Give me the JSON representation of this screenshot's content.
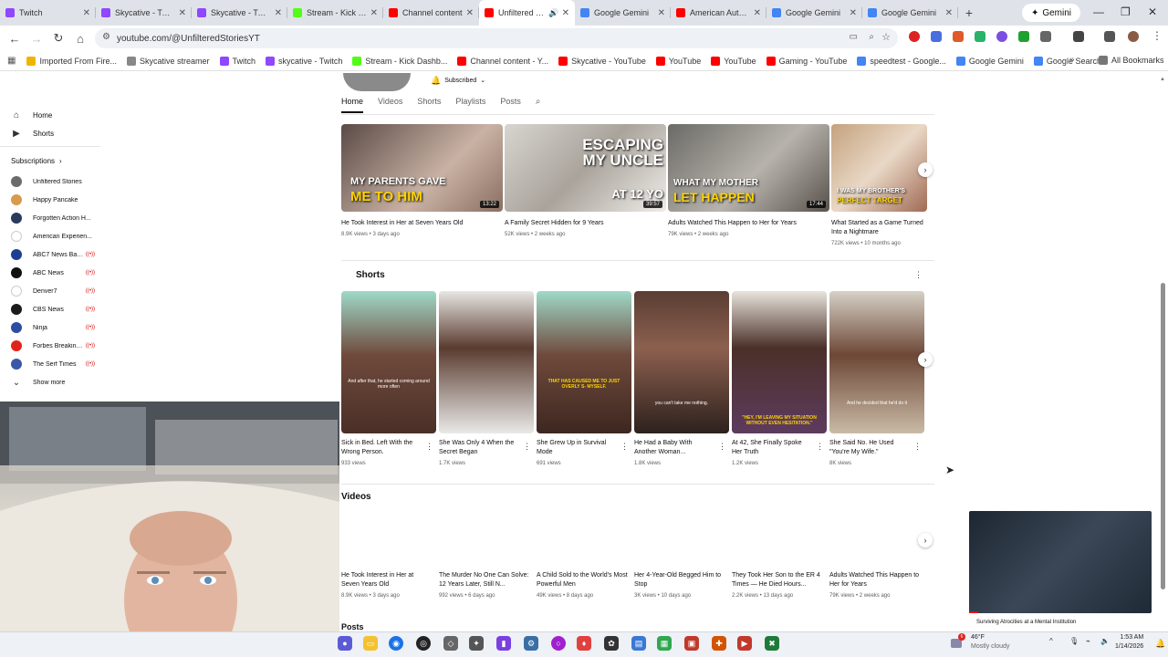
{
  "tabs": [
    {
      "label": "Twitch",
      "color": "#9146ff"
    },
    {
      "label": "Skycative - Twitch",
      "color": "#9146ff"
    },
    {
      "label": "Skycative - Twitch",
      "color": "#9146ff"
    },
    {
      "label": "Stream - Kick Dashboard",
      "color": "#53fc18"
    },
    {
      "label": "Channel content",
      "color": "#ff0000"
    },
    {
      "label": "Unfiltered Stories",
      "color": "#ff0000"
    },
    {
      "label": "Google Gemini",
      "color": "#4285f4"
    },
    {
      "label": "American Authorities",
      "color": "#ff0000"
    },
    {
      "label": "Google Gemini",
      "color": "#4285f4"
    },
    {
      "label": "Google Gemini",
      "color": "#4285f4"
    }
  ],
  "gemini_button": "Gemini",
  "address": {
    "url": "youtube.com/@UnfilteredStoriesYT"
  },
  "bookmarks": [
    {
      "label": "Imported From Fire...",
      "color": "#f0b400"
    },
    {
      "label": "Skycative streamer",
      "color": "#888888"
    },
    {
      "label": "Twitch",
      "color": "#9146ff"
    },
    {
      "label": "skycative - Twitch",
      "color": "#9146ff"
    },
    {
      "label": "Stream - Kick Dashb...",
      "color": "#53fc18"
    },
    {
      "label": "Channel content - Y...",
      "color": "#ff0000"
    },
    {
      "label": "Skycative - YouTube",
      "color": "#ff0000"
    },
    {
      "label": "YouTube",
      "color": "#ff0000"
    },
    {
      "label": "YouTube",
      "color": "#ff0000"
    },
    {
      "label": "Gaming - YouTube",
      "color": "#ff0000"
    },
    {
      "label": "speedtest - Google...",
      "color": "#4285f4"
    },
    {
      "label": "Google Gemini",
      "color": "#4285f4"
    },
    {
      "label": "Google Search",
      "color": "#4285f4"
    }
  ],
  "all_bookmarks": "All Bookmarks",
  "sidebar": {
    "home": "Home",
    "shorts": "Shorts",
    "subscriptions_label": "Subscriptions",
    "subscriptions": [
      {
        "label": "Unfiltered Stories",
        "color": "#6b6b6b",
        "live": false
      },
      {
        "label": "Happy Pancake",
        "color": "#d99a4e",
        "live": false
      },
      {
        "label": "Forgotten Action H...",
        "color": "#2a3a5c",
        "live": false
      },
      {
        "label": "American Experien...",
        "color": "#ffffff",
        "live": false
      },
      {
        "label": "ABC7 News Bay ...",
        "color": "#1c3f94",
        "live": true
      },
      {
        "label": "ABC News",
        "color": "#111111",
        "live": true
      },
      {
        "label": "Denver7",
        "color": "#ffffff",
        "live": true
      },
      {
        "label": "CBS News",
        "color": "#1b1b1b",
        "live": true
      },
      {
        "label": "Ninja",
        "color": "#2b4ea0",
        "live": true
      },
      {
        "label": "Forbes Breaking ...",
        "color": "#e0231d",
        "live": true
      },
      {
        "label": "The Serf Times",
        "color": "#3a57a8",
        "live": true
      }
    ],
    "show_more": "Show more"
  },
  "channel": {
    "subscribed_label": "Subscribed",
    "tabs": [
      "Home",
      "Videos",
      "Shorts",
      "Playlists",
      "Posts"
    ]
  },
  "featured_videos": [
    {
      "title": "He Took Interest in Her at Seven Years Old",
      "meta": "8.9K views • 3 days ago",
      "duration": "13:22",
      "caption_top": "MY PARENTS GAVE",
      "caption_bottom": "ME TO HIM"
    },
    {
      "title": "A Family Secret Hidden for 9 Years",
      "meta": "52K views • 2 weeks ago",
      "duration": "39:57",
      "caption_top": "ESCAPING MY UNCLE",
      "caption_bottom": "AT 12 YO"
    },
    {
      "title": "Adults Watched This Happen to Her for Years",
      "meta": "79K views • 2 weeks ago",
      "duration": "17:44",
      "caption_top": "WHAT MY MOTHER",
      "caption_bottom": "LET HAPPEN"
    },
    {
      "title": "What Started as a Game Turned Into a Nightmare",
      "meta": "722K views • 10 months ago",
      "duration": "",
      "caption_top": "I WAS MY BROTHER'S",
      "caption_bottom": "PERFECT TARGET"
    }
  ],
  "shorts": {
    "title": "Shorts",
    "items": [
      {
        "title": "Sick in Bed. Left With the Wrong Person.",
        "meta": "933 views",
        "caption": "And after that, he started coming around more often"
      },
      {
        "title": "She Was Only 4 When the Secret Began",
        "meta": "1.7K views",
        "caption": ""
      },
      {
        "title": "She Grew Up in Survival Mode",
        "meta": "691 views",
        "caption": "THAT HAS CAUSED ME TO JUST OVERLY S- MYSELF."
      },
      {
        "title": "He Had a Baby With Another Woman...",
        "meta": "1.8K views",
        "caption": "you can't take me nothing."
      },
      {
        "title": "At 42, She Finally Spoke Her Truth",
        "meta": "1.2K views",
        "caption": "\"HEY, I'M LEAVING MY SITUATION WITHOUT EVEN HESITATION.\""
      },
      {
        "title": "She Said No. He Used \"You're My Wife.\"",
        "meta": "8K views",
        "caption": "And he decided that he'd do it"
      }
    ]
  },
  "videos_section": {
    "title": "Videos",
    "items": [
      {
        "title": "He Took Interest in Her at Seven Years Old",
        "meta": "8.9K views • 3 days ago"
      },
      {
        "title": "The Murder No One Can Solve: 12 Years Later, Still N...",
        "meta": "992 views • 6 days ago"
      },
      {
        "title": "A Child Sold to the World's Most Powerful Men",
        "meta": "49K views • 8 days ago"
      },
      {
        "title": "Her 4-Year-Old Begged Him to Stop",
        "meta": "3K views • 10 days ago"
      },
      {
        "title": "They Took Her Son to the ER 4 Times — He Died Hours...",
        "meta": "2.2K views • 13 days ago"
      },
      {
        "title": "Adults Watched This Happen to Her for Years",
        "meta": "79K views • 2 weeks ago"
      }
    ]
  },
  "posts_section": {
    "title": "Posts"
  },
  "mini_player": {
    "title": "Surviving Atrocities at a Mental Institution"
  },
  "taskbar": {
    "weather_temp": "46°F",
    "weather_desc": "Mostly cloudy",
    "notification_count": "6",
    "time": "1:53 AM",
    "date": "1/14/2026"
  }
}
